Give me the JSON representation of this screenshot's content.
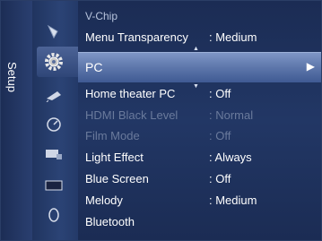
{
  "side_tab": {
    "label": "Setup"
  },
  "menu": {
    "header": "V-Chip",
    "selected": {
      "label": "PC",
      "arrow": "▶"
    },
    "rows": [
      {
        "key": "Menu Transparency",
        "value": ": Medium",
        "disabled": false
      },
      {
        "key": "Home theater PC",
        "value": ": Off",
        "disabled": false
      },
      {
        "key": "HDMI Black Level",
        "value": ": Normal",
        "disabled": true
      },
      {
        "key": "Film Mode",
        "value": ": Off",
        "disabled": true
      },
      {
        "key": "Light Effect",
        "value": ": Always",
        "disabled": false
      },
      {
        "key": "Blue Screen",
        "value": ": Off",
        "disabled": false
      },
      {
        "key": "Melody",
        "value": ": Medium",
        "disabled": false
      },
      {
        "key": "Bluetooth",
        "value": "",
        "disabled": false
      }
    ],
    "scroll": {
      "up": "▲",
      "down": "▼"
    }
  },
  "icons": [
    "picture-icon",
    "setup-gear-icon",
    "channel-satellite-icon",
    "timer-clock-icon",
    "input-source-icon",
    "screen-icon",
    "speaker-icon"
  ]
}
